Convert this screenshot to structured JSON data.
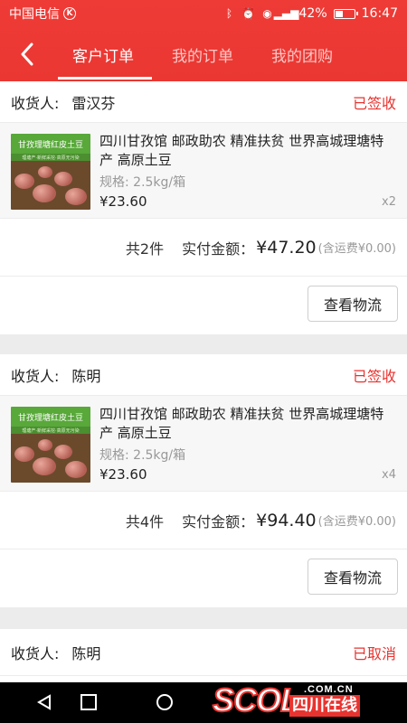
{
  "status_bar": {
    "carrier": "中国电信",
    "carrier_badge": "K",
    "battery": "42%",
    "time": "16:47"
  },
  "nav": {
    "tabs": [
      {
        "label": "客户订单",
        "active": true
      },
      {
        "label": "我的订单",
        "active": false
      },
      {
        "label": "我的团购",
        "active": false
      }
    ]
  },
  "labels": {
    "receiver": "收货人:",
    "spec_prefix": "规格:",
    "total_count_prefix": "共",
    "total_count_suffix": "件",
    "paid_label": "实付金额：",
    "logistics_button": "查看物流"
  },
  "orders": [
    {
      "receiver": "雷汉芬",
      "status": "已签收",
      "product": {
        "title": "四川甘孜馆 邮政助农 精准扶贫 世界高城理塘特产 高原土豆",
        "spec": "2.5kg/箱",
        "price": "¥23.60",
        "qty": "x2",
        "thumb_title": "甘孜理塘红皮土豆",
        "thumb_sub": "理塘产·新鲜采挖·高原无污染"
      },
      "count": "2",
      "amount": "¥47.20",
      "shipping": "(含运费¥0.00)"
    },
    {
      "receiver": "陈明",
      "status": "已签收",
      "product": {
        "title": "四川甘孜馆 邮政助农 精准扶贫 世界高城理塘特产 高原土豆",
        "spec": "2.5kg/箱",
        "price": "¥23.60",
        "qty": "x4",
        "thumb_title": "甘孜理塘红皮土豆",
        "thumb_sub": "理塘产·新鲜采挖·高原无污染"
      },
      "count": "4",
      "amount": "¥94.40",
      "shipping": "(含运费¥0.00)"
    },
    {
      "receiver": "陈明",
      "status": "已取消"
    }
  ],
  "watermark": {
    "logo": "SCOL",
    "domain": ".COM.CN",
    "name": "四川在线"
  },
  "colors": {
    "primary": "#ea3732",
    "status": "#e8332f"
  }
}
